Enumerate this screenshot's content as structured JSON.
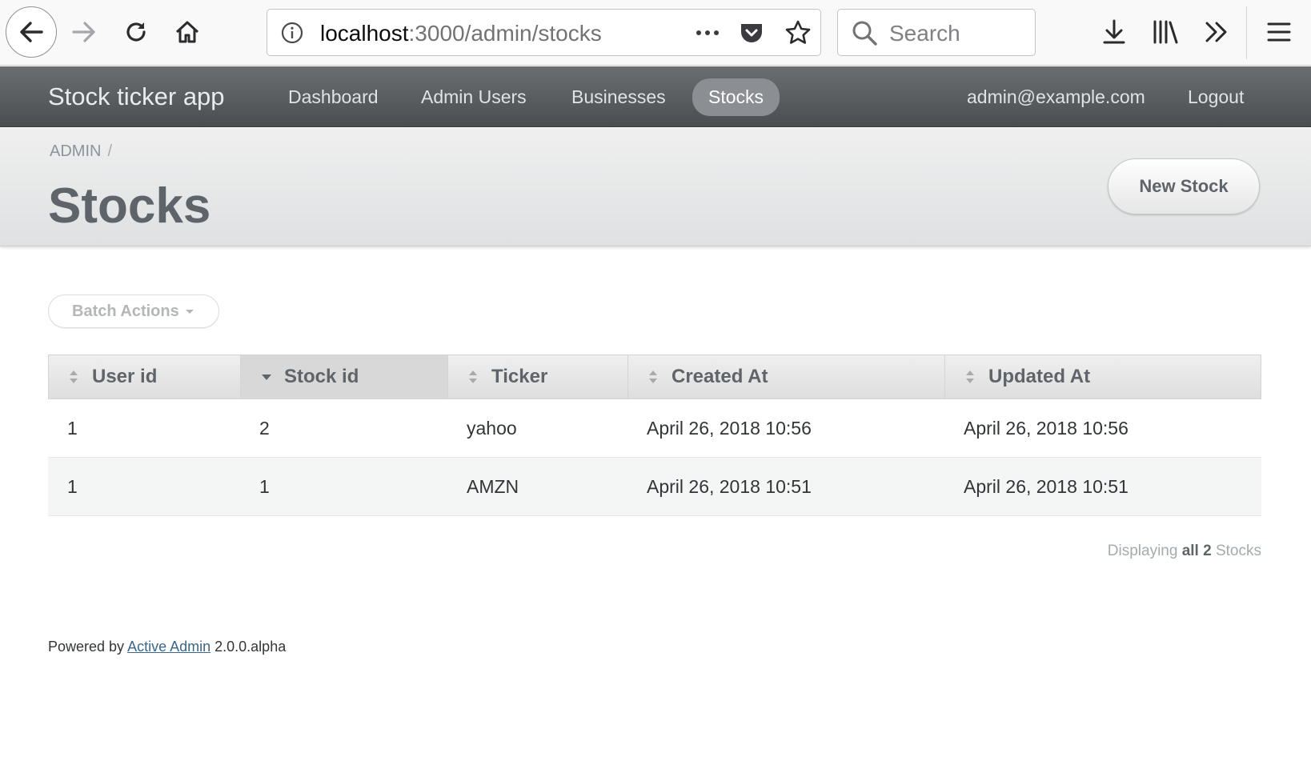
{
  "browser": {
    "url_host": "localhost",
    "url_rest": ":3000/admin/stocks",
    "search_placeholder": "Search"
  },
  "header": {
    "site_title": "Stock ticker app",
    "tabs": [
      {
        "label": "Dashboard",
        "active": false
      },
      {
        "label": "Admin Users",
        "active": false
      },
      {
        "label": "Businesses",
        "active": false
      },
      {
        "label": "Stocks",
        "active": true
      }
    ],
    "user_email": "admin@example.com",
    "logout_label": "Logout"
  },
  "title_bar": {
    "breadcrumb": "ADMIN",
    "breadcrumb_sep": "/",
    "title": "Stocks",
    "new_button": "New Stock"
  },
  "batch_actions_label": "Batch Actions",
  "table": {
    "headers": [
      "User id",
      "Stock id",
      "Ticker",
      "Created At",
      "Updated At"
    ],
    "sorted_column": "Stock id",
    "sort_direction": "desc",
    "rows": [
      [
        "1",
        "2",
        "yahoo",
        "April 26, 2018 10:56",
        "April 26, 2018 10:56"
      ],
      [
        "1",
        "1",
        "AMZN",
        "April 26, 2018 10:51",
        "April 26, 2018 10:51"
      ]
    ]
  },
  "pagination": {
    "prefix": "Displaying",
    "bold": "all 2",
    "suffix": "Stocks"
  },
  "footer": {
    "prefix": "Powered by",
    "link": "Active Admin",
    "version": "2.0.0.alpha"
  },
  "colors": {
    "header_bg": "#5b5f62",
    "active_tab": "#8b8f93",
    "title_text": "#5e6469",
    "link": "#38678b"
  }
}
